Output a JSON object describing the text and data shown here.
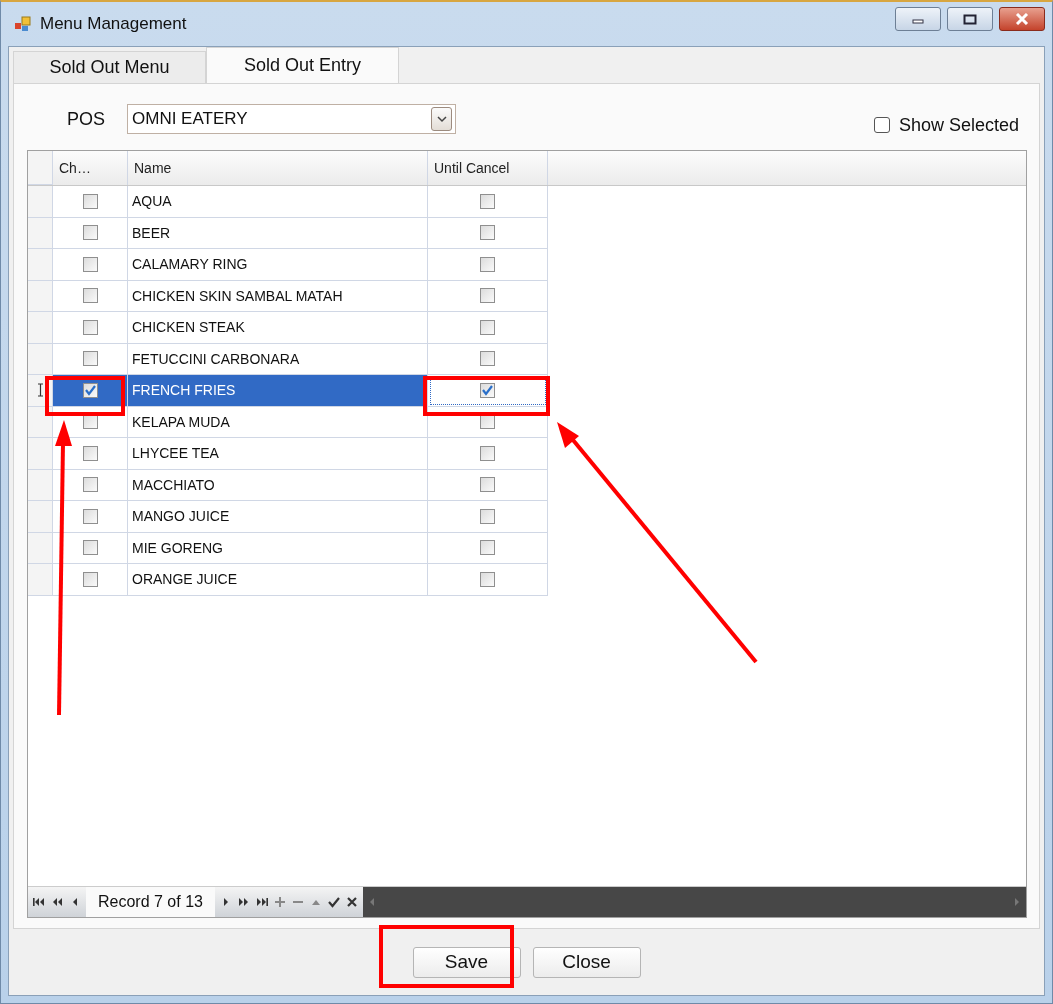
{
  "window": {
    "title": "Menu Management"
  },
  "tabs": [
    {
      "label": "Sold Out Menu",
      "selected": false
    },
    {
      "label": "Sold Out Entry",
      "selected": true
    }
  ],
  "pos": {
    "label": "POS",
    "value": "OMNI EATERY"
  },
  "show_selected": {
    "label": "Show Selected",
    "checked": false
  },
  "table": {
    "columns": [
      "Ch…",
      "Name",
      "Until Cancel"
    ],
    "rows": [
      {
        "name": "AQUA",
        "checked": false,
        "until_cancel": false,
        "selected": false
      },
      {
        "name": "BEER",
        "checked": false,
        "until_cancel": false,
        "selected": false
      },
      {
        "name": "CALAMARY RING",
        "checked": false,
        "until_cancel": false,
        "selected": false
      },
      {
        "name": "CHICKEN SKIN SAMBAL MATAH",
        "checked": false,
        "until_cancel": false,
        "selected": false
      },
      {
        "name": "CHICKEN STEAK",
        "checked": false,
        "until_cancel": false,
        "selected": false
      },
      {
        "name": "FETUCCINI CARBONARA",
        "checked": false,
        "until_cancel": false,
        "selected": false
      },
      {
        "name": "FRENCH FRIES",
        "checked": true,
        "until_cancel": true,
        "selected": true
      },
      {
        "name": "KELAPA MUDA",
        "checked": false,
        "until_cancel": false,
        "selected": false
      },
      {
        "name": "LHYCEE TEA",
        "checked": false,
        "until_cancel": false,
        "selected": false
      },
      {
        "name": "MACCHIATO",
        "checked": false,
        "until_cancel": false,
        "selected": false
      },
      {
        "name": "MANGO JUICE",
        "checked": false,
        "until_cancel": false,
        "selected": false
      },
      {
        "name": "MIE GORENG",
        "checked": false,
        "until_cancel": false,
        "selected": false
      },
      {
        "name": "ORANGE JUICE",
        "checked": false,
        "until_cancel": false,
        "selected": false
      }
    ]
  },
  "navigator": {
    "record": "Record 7 of 13"
  },
  "buttons": [
    "Save",
    "Close"
  ]
}
